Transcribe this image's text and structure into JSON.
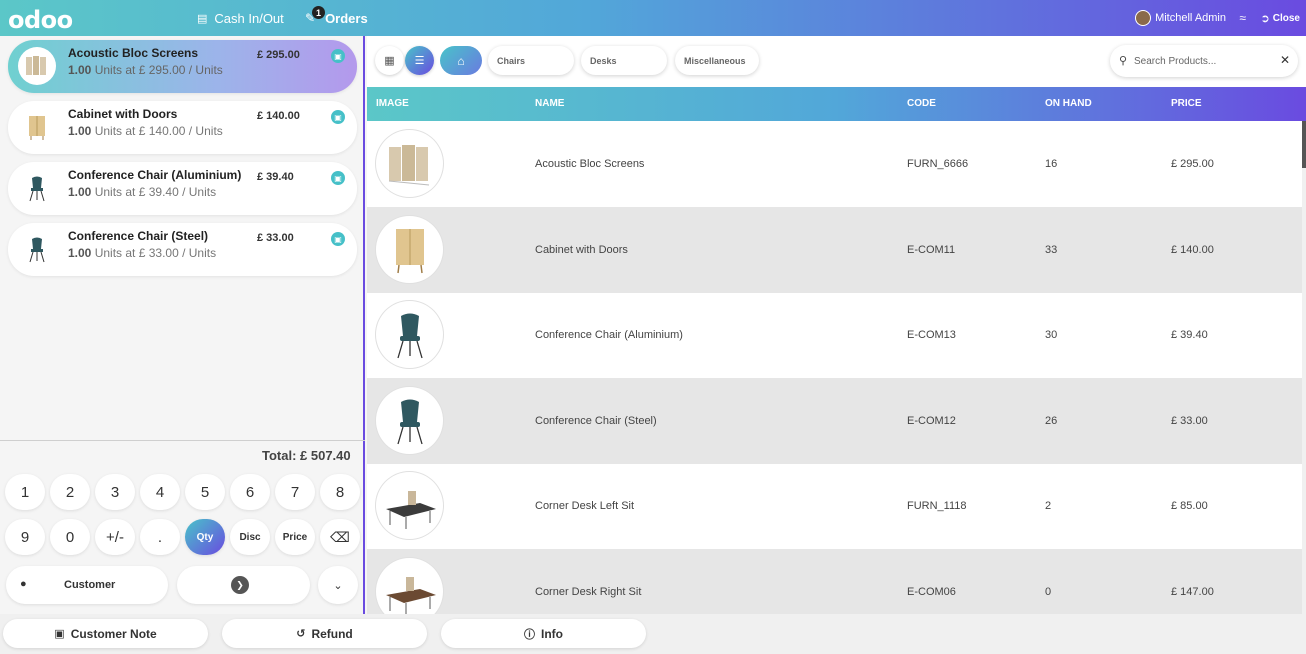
{
  "header": {
    "logo": "odoo",
    "cash_label": "Cash In/Out",
    "orders_label": "Orders",
    "orders_badge": "1",
    "user_name": "Mitchell Admin",
    "close_label": "Close"
  },
  "order": {
    "lines": [
      {
        "name": "Acoustic Bloc Screens",
        "qty": "1.00",
        "detail": "Units at £ 295.00 / Units",
        "price": "£ 295.00",
        "icon": "screen-product-icon"
      },
      {
        "name": "Cabinet with Doors",
        "qty": "1.00",
        "detail": "Units at £ 140.00 / Units",
        "price": "£ 140.00",
        "icon": "cabinet-product-icon"
      },
      {
        "name": "Conference Chair (Aluminium)",
        "qty": "1.00",
        "detail": "Units at £ 39.40 / Units",
        "price": "£ 39.40",
        "icon": "chair-product-icon"
      },
      {
        "name": "Conference Chair (Steel)",
        "qty": "1.00",
        "detail": "Units at £ 33.00 / Units",
        "price": "£ 33.00",
        "icon": "chair-product-icon"
      }
    ],
    "total": "Total: £ 507.40"
  },
  "numpad": {
    "row1": [
      "1",
      "2",
      "3",
      "4",
      "5",
      "6",
      "7",
      "8"
    ],
    "row2": [
      "9",
      "0",
      "+/-",
      ".",
      "Qty",
      "Disc",
      "Price"
    ],
    "active": "Qty"
  },
  "actions": {
    "customer_label": "Customer"
  },
  "bottom": {
    "customer_note": "Customer Note",
    "refund": "Refund",
    "info": "Info"
  },
  "categories": {
    "items": [
      "Chairs",
      "Desks",
      "Miscellaneous"
    ]
  },
  "search": {
    "placeholder": "Search Products..."
  },
  "table": {
    "headers": [
      "IMAGE",
      "NAME",
      "CODE",
      "ON HAND",
      "PRICE"
    ],
    "rows": [
      {
        "name": "Acoustic Bloc Screens",
        "code": "FURN_6666",
        "on_hand": "16",
        "price": "£ 295.00",
        "icon": "screen-product-icon"
      },
      {
        "name": "Cabinet with Doors",
        "code": "E-COM11",
        "on_hand": "33",
        "price": "£ 140.00",
        "icon": "cabinet-product-icon"
      },
      {
        "name": "Conference Chair (Aluminium)",
        "code": "E-COM13",
        "on_hand": "30",
        "price": "£ 39.40",
        "icon": "chair-product-icon"
      },
      {
        "name": "Conference Chair (Steel)",
        "code": "E-COM12",
        "on_hand": "26",
        "price": "£ 33.00",
        "icon": "chair-product-icon"
      },
      {
        "name": "Corner Desk Left Sit",
        "code": "FURN_1118",
        "on_hand": "2",
        "price": "£ 85.00",
        "icon": "desk-product-icon"
      },
      {
        "name": "Corner Desk Right Sit",
        "code": "E-COM06",
        "on_hand": "0",
        "price": "£ 147.00",
        "icon": "desk-product-icon"
      }
    ]
  },
  "colors": {
    "accent_teal": "#5bc7c8",
    "accent_purple": "#6a4be0",
    "row_alt": "#e6e6e6"
  }
}
